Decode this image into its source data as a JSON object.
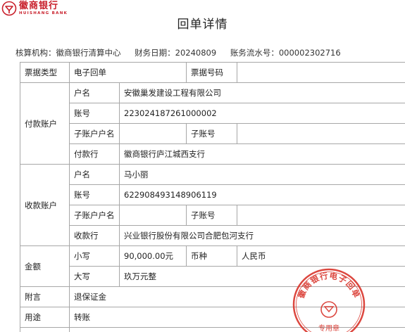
{
  "brand": {
    "name_cn": "徽商银行",
    "name_en": "HUISHANG BANK",
    "primary_color": "#c81e2a"
  },
  "page_title": "回单详情",
  "meta": {
    "institution": "核算机构：徽商银行清算中心",
    "date": "财务日期：20240809",
    "serial": "账务流水号：000002302716"
  },
  "table": {
    "bill_type_label": "票据类型",
    "bill_type_value": "电子回单",
    "bill_no_label": "票据号码",
    "bill_no_value": "",
    "payer": {
      "group_label": "付款账户",
      "name_label": "户名",
      "name_value": "安徽巢发建设工程有限公司",
      "account_label": "账号",
      "account_value": "223024187261000002",
      "sub_name_label": "子账户户名",
      "sub_name_value": "",
      "sub_no_label": "子账号",
      "sub_no_value": "",
      "bank_label": "付款行",
      "bank_value": "徽商银行庐江城西支行"
    },
    "payee": {
      "group_label": "收款账户",
      "name_label": "户名",
      "name_value": "马小丽",
      "account_label": "账号",
      "account_value": "622908493148906119",
      "sub_name_label": "子账户户名",
      "sub_name_value": "",
      "sub_no_label": "子账号",
      "sub_no_value": "",
      "bank_label": "收款行",
      "bank_value": "兴业银行股份有限公司合肥包河支行"
    },
    "amount": {
      "group_label": "金额",
      "lower_label": "小写",
      "lower_value": "90,000.00元",
      "currency_label": "币种",
      "currency_value": "人民币",
      "upper_label": "大写",
      "upper_value": "玖万元整"
    },
    "postscript_label": "附言",
    "postscript_value": "退保证金",
    "purpose_label": "用途",
    "purpose_value": "转账"
  },
  "seal": {
    "text": "徽商银行电子回单",
    "sub_text": "专用章",
    "color": "#d9342b"
  }
}
